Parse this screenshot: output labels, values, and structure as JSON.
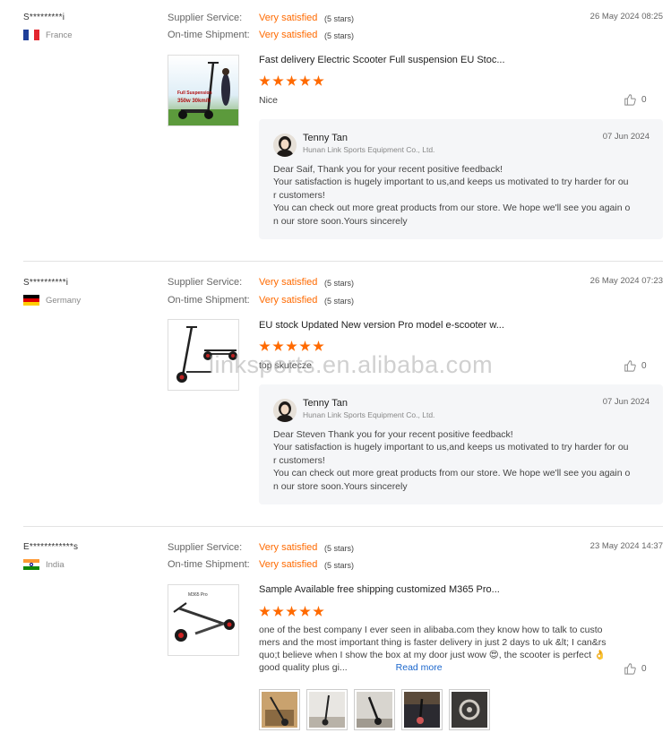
{
  "labels": {
    "supplier_service": "Supplier Service:",
    "ontime_shipment": "On-time Shipment:"
  },
  "reviews": [
    {
      "reviewer": "S*********i",
      "country": "France",
      "date": "26 May 2024 08:25",
      "supplier_service_value": "Very satisfied",
      "supplier_service_stars": "(5 stars)",
      "shipment_value": "Very satisfied",
      "shipment_stars": "(5 stars)",
      "product_title": "Fast delivery Electric Scooter Full suspension EU Stoc...",
      "thumb_caption_1": "Full Suspension",
      "thumb_caption_2": "350w 30km/h",
      "rating": 5,
      "comment": "Nice",
      "likes": "0",
      "reply": {
        "name": "Tenny Tan",
        "company": "Hunan Link Sports Equipment Co., Ltd.",
        "date": "07 Jun 2024",
        "line1": "Dear Saif,  Thank you for your recent positive feedback!",
        "line2": "Your satisfaction is hugely important to us,and keeps us motivated to try harder for ou",
        "line3": "r customers!",
        "line4": "You can check out more great products from our store. We hope we'll see you again o",
        "line5": "n our store soon.Yours sincerely"
      }
    },
    {
      "reviewer": "S**********i",
      "country": "Germany",
      "date": "26 May 2024 07:23",
      "supplier_service_value": "Very satisfied",
      "supplier_service_stars": "(5 stars)",
      "shipment_value": "Very satisfied",
      "shipment_stars": "(5 stars)",
      "product_title": "EU stock Updated New version Pro model e-scooter w...",
      "rating": 5,
      "comment": "top skutecze",
      "likes": "0",
      "reply": {
        "name": "Tenny Tan",
        "company": "Hunan Link Sports Equipment Co., Ltd.",
        "date": "07 Jun 2024",
        "line1": "Dear Steven  Thank you for your recent positive feedback!",
        "line2": "Your satisfaction is hugely important to us,and keeps us motivated to try harder for ou",
        "line3": "r customers!",
        "line4": "You can check out more great products from our store. We hope we'll see you again o",
        "line5": "n our store soon.Yours sincerely"
      }
    },
    {
      "reviewer": "E************s",
      "country": "India",
      "date": "23 May 2024 14:37",
      "supplier_service_value": "Very satisfied",
      "supplier_service_stars": "(5 stars)",
      "shipment_value": "Very satisfied",
      "shipment_stars": "(5 stars)",
      "product_title": "Sample Available free shipping customized M365 Pro...",
      "thumb_caption_1": "M365 Pro",
      "rating": 5,
      "comment_line1": "one of the best company I ever seen in alibaba.com they know how to talk to custo",
      "comment_line2": "mers and the most important thing is faster delivery in just 2 days to uk &lt; I can&rs",
      "comment_line3": "quo;t believe when I show the box at my door just wow 😍, the scooter is perfect 👌",
      "comment_line4": "good quality plus gi...",
      "read_more": "Read more",
      "likes": "0"
    }
  ],
  "watermark": "linksports.en.alibaba.com",
  "colors": {
    "accent": "#ff6a00",
    "link": "#1a66cc",
    "reply_bg": "#f5f6f8"
  }
}
